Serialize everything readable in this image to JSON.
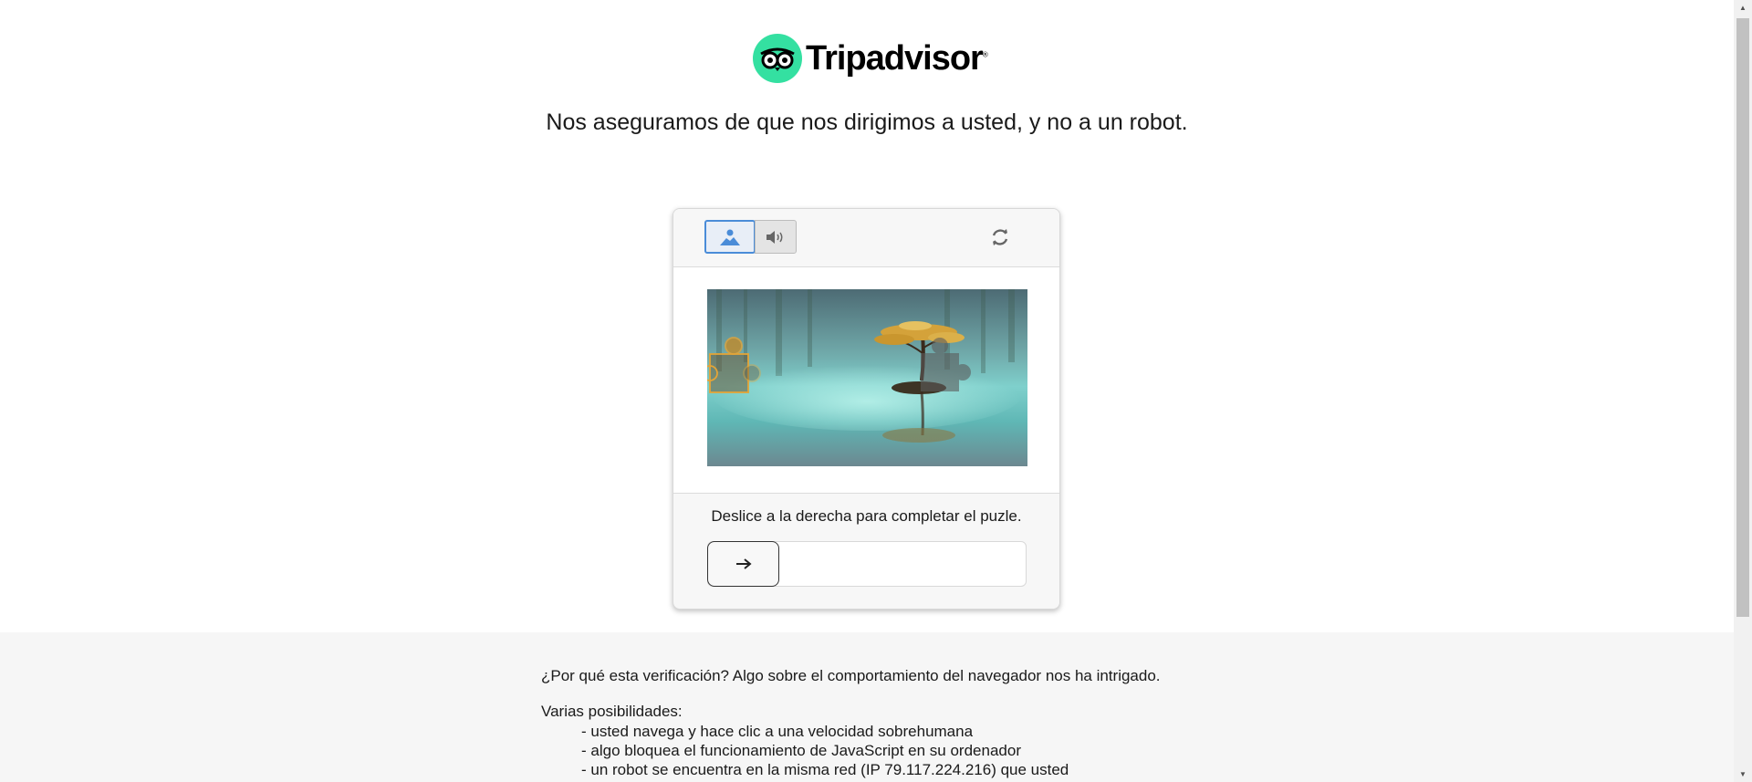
{
  "logo": {
    "text": "Tripadvisor",
    "trademark": "®",
    "icon": "owl-eyes-icon",
    "brand_color": "#34e0a1"
  },
  "headline": "Nos aseguramos de que nos dirigimos a usted, y no a un robot.",
  "captcha": {
    "tabs": [
      {
        "icon": "image-icon",
        "active": true
      },
      {
        "icon": "speaker-icon",
        "active": false
      }
    ],
    "refresh_icon": "refresh-icon",
    "puzzle_image": "lake-tree-landscape",
    "instruction": "Deslice a la derecha para completar el puzle.",
    "slider_icon": "arrow-right-icon",
    "slider_progress": 0,
    "accent_color": "#4a8cd8"
  },
  "footer": {
    "why": "¿Por qué esta verificación? Algo sobre el comportamiento del navegador nos ha intrigado.",
    "possibilities_title": "Varias posibilidades:",
    "possibilities": [
      "- usted navega y hace clic a una velocidad sobrehumana",
      "- algo bloquea el funcionamiento de JavaScript en su ordenador",
      "- un robot se encuentra en la misma red (IP 79.117.224.216) que usted"
    ]
  }
}
